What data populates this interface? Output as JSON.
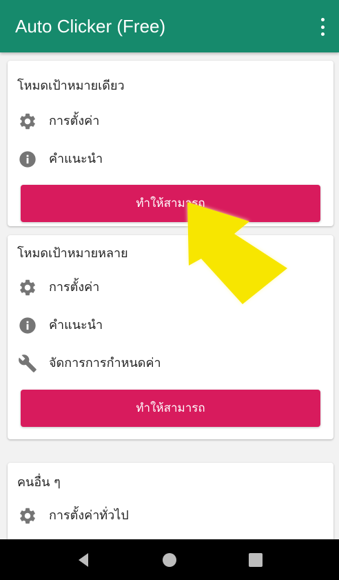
{
  "app": {
    "title": "Auto Clicker (Free)"
  },
  "cards": [
    {
      "title": "โหมดเป้าหมายเดียว",
      "items": [
        {
          "icon": "gear-icon",
          "label": "การตั้งค่า"
        },
        {
          "icon": "info-icon",
          "label": "คำแนะนำ"
        }
      ],
      "button": "ทำให้สามารถ"
    },
    {
      "title": "โหมดเป้าหมายหลาย",
      "items": [
        {
          "icon": "gear-icon",
          "label": "การตั้งค่า"
        },
        {
          "icon": "info-icon",
          "label": "คำแนะนำ"
        },
        {
          "icon": "wrench-icon",
          "label": "จัดการการกำหนดค่า"
        }
      ],
      "button": "ทำให้สามารถ"
    },
    {
      "title": "คนอื่น ๆ",
      "items": [
        {
          "icon": "gear-icon",
          "label": "การตั้งค่าทั่วไป"
        }
      ]
    }
  ],
  "navbar": {
    "buttons": [
      "back-icon",
      "home-icon",
      "recents-icon"
    ]
  },
  "colors": {
    "appbar": "#168a6c",
    "button": "#d81b5d",
    "icon": "#757575",
    "highlight_arrow": "#f7e600",
    "background": "#f2f2f2"
  }
}
